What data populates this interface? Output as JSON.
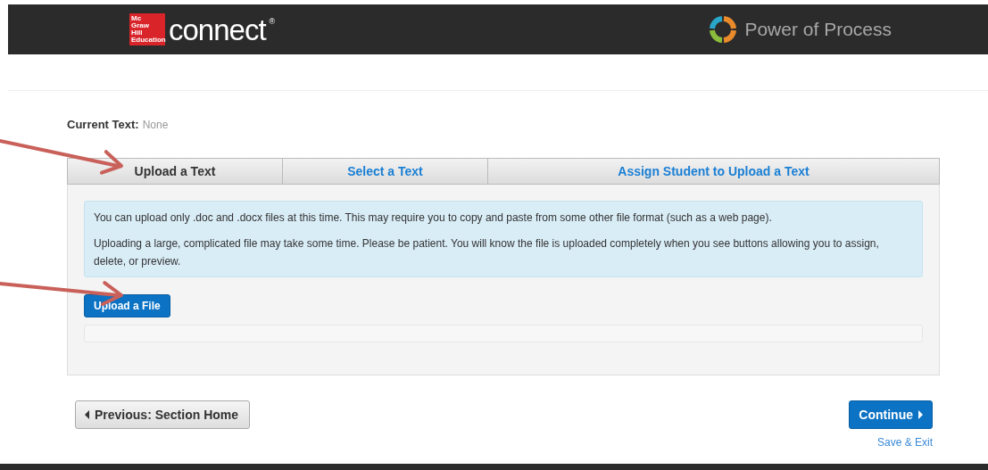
{
  "header": {
    "logo_badge": [
      "Mc",
      "Graw",
      "Hill",
      "Education"
    ],
    "logo_word": "connect",
    "logo_mark": "®",
    "brand": "Power of Process"
  },
  "current_text": {
    "label": "Current Text:",
    "value": "None"
  },
  "tabs": [
    {
      "label": "Upload a Text",
      "selected": true
    },
    {
      "label": "Select a Text",
      "selected": false
    },
    {
      "label": "Assign Student to Upload a Text",
      "selected": false
    }
  ],
  "info": [
    "You can upload only .doc and .docx files at this time. This may require you to copy and paste from some other file format (such as a web page).",
    "Uploading a large, complicated file may take some time. Please be patient. You will know the file is uploaded completely when you see buttons allowing you to assign, delete, or preview."
  ],
  "upload_button": "Upload a File",
  "nav": {
    "previous": "Previous: Section Home",
    "continue": "Continue",
    "save_exit": "Save & Exit"
  }
}
